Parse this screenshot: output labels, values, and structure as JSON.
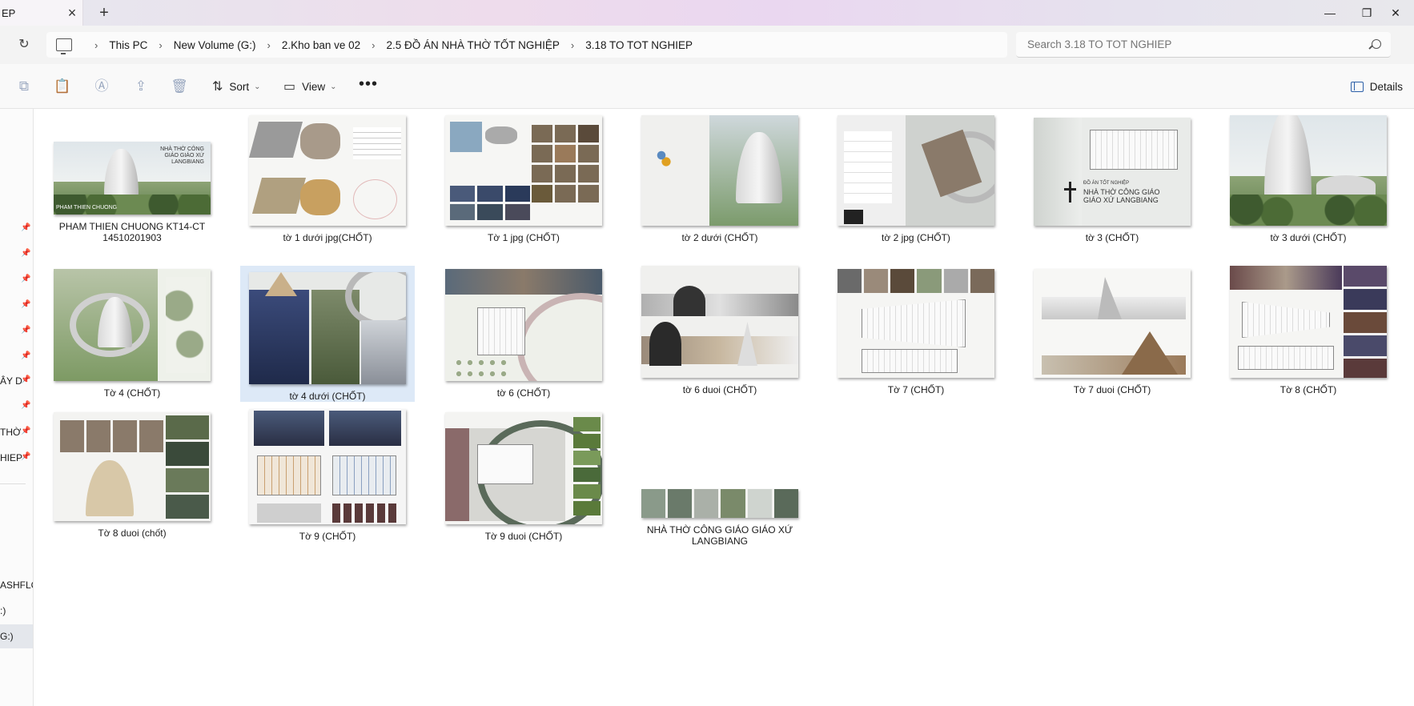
{
  "window": {
    "tab_title": "EP",
    "new_tab": "+",
    "minimize": "—",
    "maximize": "❐",
    "close": "✕"
  },
  "address": {
    "crumbs": [
      "This PC",
      "New Volume (G:)",
      "2.Kho ban ve 02",
      "2.5 ĐỒ ÁN NHÀ THỜ TỐT NGHIỆP",
      "3.18 TO TOT NGHIEP"
    ],
    "search_placeholder": "Search 3.18 TO TOT NGHIEP"
  },
  "toolbar": {
    "sort_label": "Sort",
    "view_label": "View",
    "more_label": "•••",
    "details_label": "Details"
  },
  "sidebar": {
    "items": [
      {
        "label": "ÂY D"
      },
      {
        "label": "THỜ"
      },
      {
        "label": "HIEP"
      },
      {
        "label": "ASHFLC"
      },
      {
        "label": ":)"
      },
      {
        "label": "G:)"
      }
    ]
  },
  "files": [
    {
      "name": "PHAM THIEN CHUONG KT14-CT 14510201903"
    },
    {
      "name": "tờ 1 dưới jpg(CHỐT)"
    },
    {
      "name": "Tờ 1 jpg (CHỐT)"
    },
    {
      "name": "tờ 2 dưới (CHỐT)"
    },
    {
      "name": "tờ 2 jpg (CHỐT)"
    },
    {
      "name": "tờ 3 (CHỐT)"
    },
    {
      "name": "tờ 3 dưới (CHỐT)"
    },
    {
      "name": "Tờ 4 (CHỐT)"
    },
    {
      "name": "tờ 4 dưới (CHỐT)"
    },
    {
      "name": "tờ 6 (CHỐT)"
    },
    {
      "name": "tờ 6 duoi (CHỐT)"
    },
    {
      "name": "Tờ 7 (CHỐT)"
    },
    {
      "name": "Tờ 7 duoi (CHỐT)"
    },
    {
      "name": "Tờ 8 (CHỐT)"
    },
    {
      "name": "Tờ 8 duoi (chốt)"
    },
    {
      "name": "Tờ 9 (CHỐT)"
    },
    {
      "name": "Tờ 9 duoi (CHỐT)"
    },
    {
      "name": "NHÀ THỜ CÔNG GIÁO GIÁO XỨ LANGBIANG"
    }
  ],
  "thumb_text": {
    "t1_title": "NHÀ THỜ CÔNG GIÁO GIÁO XỨ LANGBIANG",
    "t1_author": "PHAM THIEN CHUONG",
    "t6_title": "NHÀ THỜ CÔNG GIÁO GIÁO XỨ LANGBIANG",
    "t6_sub": "ĐỒ ÁN TỐT NGHIỆP"
  },
  "colors": {
    "accent": "#2b5fa8",
    "selected_tile": "#dde9f7"
  }
}
